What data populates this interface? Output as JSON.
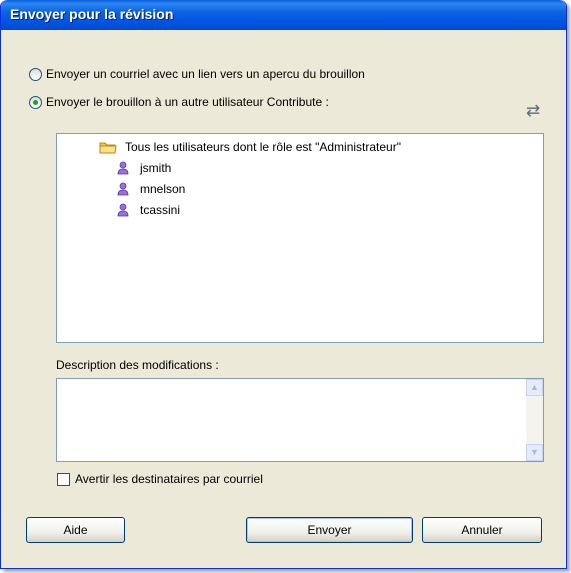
{
  "window": {
    "title": "Envoyer pour la révision"
  },
  "options": {
    "email_link_label": "Envoyer un courriel avec un lien vers un apercu du brouillon",
    "send_user_label": "Envoyer le brouillon à un autre utilisateur Contribute :",
    "selected": "send_user"
  },
  "recipients": {
    "group_label": "Tous les utilisateurs dont le rôle est \"Administrateur\"",
    "users": [
      "jsmith",
      "mnelson",
      "tcassini"
    ]
  },
  "description": {
    "label": "Description des modifications :",
    "value": ""
  },
  "notify": {
    "label": "Avertir les destinataires par courriel",
    "checked": false
  },
  "buttons": {
    "help": "Aide",
    "send": "Envoyer",
    "cancel": "Annuler"
  },
  "icons": {
    "swap": "swap-arrows-icon",
    "group": "folder-icon",
    "user": "user-icon"
  },
  "colors": {
    "titlebar": "#0054e3",
    "dialog_bg": "#ece9d8",
    "radio_dot": "#21a121",
    "user_icon": "#7b4fc9",
    "folder": "#f5c842"
  }
}
